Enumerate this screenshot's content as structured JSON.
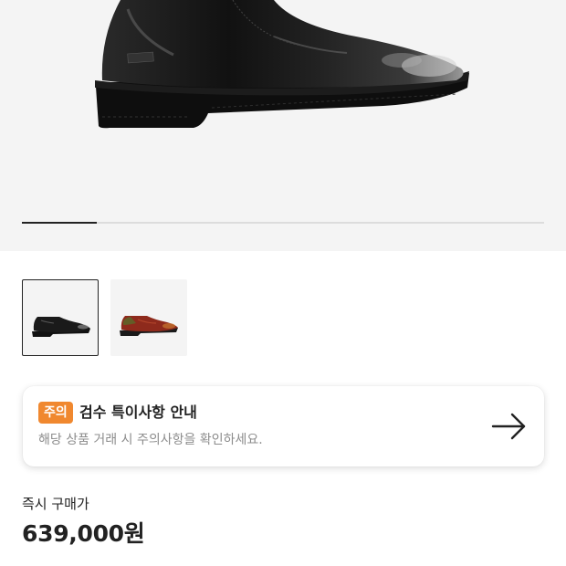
{
  "gallery": {
    "slide_index": 1,
    "slide_count": 7,
    "main_image_icon": "black-derby-shoe-image"
  },
  "thumbnails": [
    {
      "name": "black-shoe-thumbnail",
      "selected": true
    },
    {
      "name": "red-shoe-thumbnail",
      "selected": false
    }
  ],
  "notice": {
    "badge": "주의",
    "title": "검수 특이사항 안내",
    "description": "해당 상품 거래 시 주의사항을 확인하세요.",
    "arrow_icon": "arrow-right-icon",
    "badge_color": "#f0882f"
  },
  "purchase": {
    "label": "즉시 구매가",
    "price": "639,000원"
  }
}
